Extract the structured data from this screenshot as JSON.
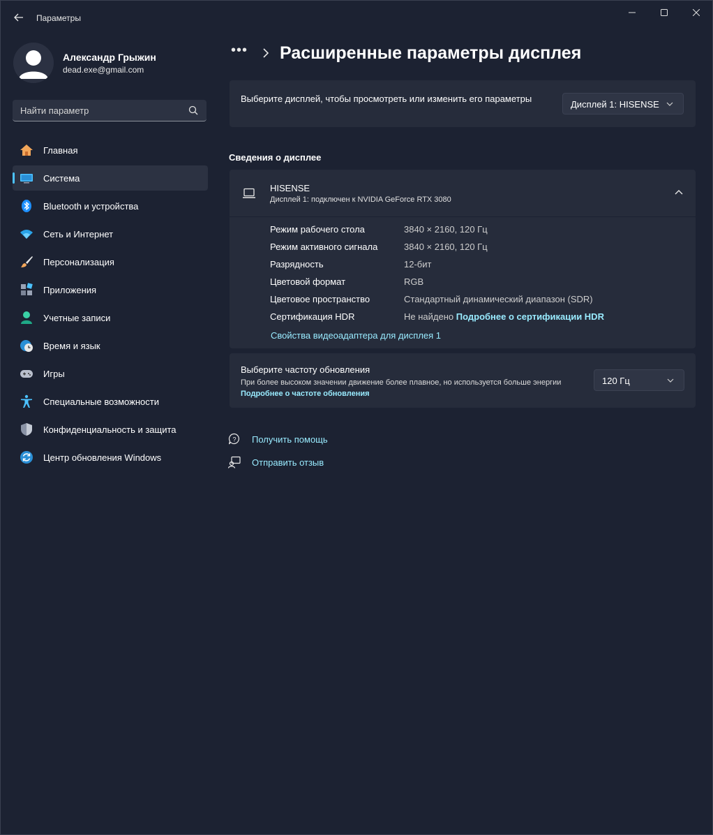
{
  "window": {
    "app_title": "Параметры",
    "back_icon": "arrow-left-icon",
    "controls": [
      "minimize-icon",
      "maximize-icon",
      "close-icon"
    ]
  },
  "profile": {
    "name": "Александр Грыжин",
    "email": "dead.exe@gmail.com"
  },
  "search": {
    "placeholder": "Найти параметр",
    "icon": "search-icon"
  },
  "sidebar": {
    "items": [
      {
        "label": "Главная",
        "icon": "home-icon"
      },
      {
        "label": "Система",
        "icon": "system-display-icon",
        "active": true
      },
      {
        "label": "Bluetooth и устройства",
        "icon": "bluetooth-icon"
      },
      {
        "label": "Сеть и Интернет",
        "icon": "wifi-icon"
      },
      {
        "label": "Персонализация",
        "icon": "brush-icon"
      },
      {
        "label": "Приложения",
        "icon": "apps-icon"
      },
      {
        "label": "Учетные записи",
        "icon": "account-icon"
      },
      {
        "label": "Время и язык",
        "icon": "globe-clock-icon"
      },
      {
        "label": "Игры",
        "icon": "gamepad-icon"
      },
      {
        "label": "Специальные возможности",
        "icon": "accessibility-icon"
      },
      {
        "label": "Конфиденциальность и защита",
        "icon": "shield-icon"
      },
      {
        "label": "Центр обновления Windows",
        "icon": "update-icon"
      }
    ],
    "accent": "#4cc2ff"
  },
  "header": {
    "dots": "•••",
    "title": "Расширенные параметры дисплея"
  },
  "display_select": {
    "prompt": "Выберите дисплей, чтобы просмотреть или изменить его параметры",
    "selected": "Дисплей 1: HISENSE"
  },
  "display_info": {
    "section_title": "Сведения о дисплее",
    "name": "HISENSE",
    "subtitle": "Дисплей 1: подключен к NVIDIA GeForce RTX 3080",
    "rows": [
      {
        "key": "Режим рабочего стола",
        "value": "3840 × 2160, 120 Гц"
      },
      {
        "key": "Режим активного сигнала",
        "value": "3840 × 2160, 120 Гц"
      },
      {
        "key": "Разрядность",
        "value": "12-бит"
      },
      {
        "key": "Цветовой формат",
        "value": "RGB"
      },
      {
        "key": "Цветовое пространство",
        "value": "Стандартный динамический диапазон (SDR)"
      },
      {
        "key": "Сертификация HDR",
        "value": "Не найдено",
        "link": "Подробнее о сертификации HDR"
      }
    ],
    "adapter_link": "Свойства видеоадаптера для дисплея 1"
  },
  "refresh_rate": {
    "title": "Выберите частоту обновления",
    "description": "При более высоком значении движение более плавное, но используется больше энергии",
    "link": "Подробнее о частоте обновления",
    "selected": "120 Гц"
  },
  "help": {
    "get_help": "Получить помощь",
    "feedback": "Отправить отзыв"
  },
  "colors": {
    "background": "#1c2232",
    "card": "#262c3b",
    "link": "#99ebff"
  }
}
